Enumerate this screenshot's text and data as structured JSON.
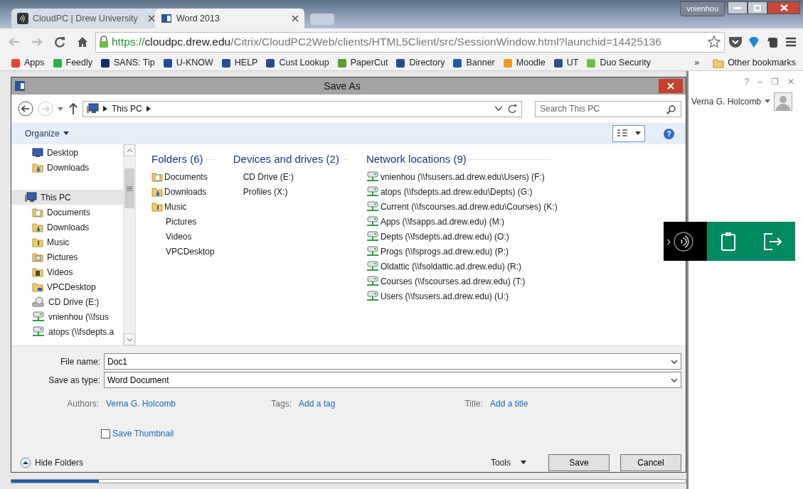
{
  "browser": {
    "tabs": [
      {
        "title": "CloudPC | Drew University",
        "selected": false,
        "kind": "citrix"
      },
      {
        "title": "Word 2013",
        "selected": true,
        "kind": "word"
      }
    ],
    "profile": "vnienhou",
    "url": {
      "scheme": "https://",
      "host": "cloudpc.drew.edu",
      "path": "/Citrix/CloudPC2Web/clients/HTML5Client/src/SessionWindow.html?launchid=14425136"
    },
    "bookmarks": [
      {
        "label": "Apps",
        "color": "#e94235"
      },
      {
        "label": "Feedly",
        "color": "#2bb24c"
      },
      {
        "label": "SANS: Tip",
        "color": "#1a2a6c"
      },
      {
        "label": "U-KNOW",
        "color": "#1f4e9c"
      },
      {
        "label": "HELP",
        "color": "#24508f"
      },
      {
        "label": "Cust Lookup",
        "color": "#2a4a8a"
      },
      {
        "label": "PaperCut",
        "color": "#5aa02c"
      },
      {
        "label": "Directory",
        "color": "#2b4c8c"
      },
      {
        "label": "Banner",
        "color": "#1d5aa8"
      },
      {
        "label": "Moodle",
        "color": "#f29a1f"
      },
      {
        "label": "UT",
        "color": "#2e4d87"
      },
      {
        "label": "Duo Security",
        "color": "#6cc04a"
      }
    ],
    "overflow": "»",
    "other_bookmarks": "Other bookmarks"
  },
  "dialog": {
    "title": "Save As",
    "breadcrumb": [
      "This PC"
    ],
    "search_placeholder": "Search This PC",
    "organize": "Organize",
    "help": "?",
    "nav_items": [
      {
        "label": "Desktop",
        "kind": "monitor",
        "selected": false
      },
      {
        "label": "Downloads",
        "kind": "download",
        "selected": false
      },
      {
        "label": "This PC",
        "kind": "computer",
        "selected": true,
        "children": [
          {
            "label": "Documents",
            "kind": "document",
            "selected": false
          },
          {
            "label": "Downloads",
            "kind": "download",
            "selected": false
          },
          {
            "label": "Music",
            "kind": "music",
            "selected": false
          },
          {
            "label": "Pictures",
            "kind": "pictures",
            "selected": false
          },
          {
            "label": "Videos",
            "kind": "videos",
            "selected": false
          },
          {
            "label": "VPCDesktop",
            "kind": "folder",
            "selected": false
          },
          {
            "label": "CD Drive (E:)",
            "kind": "disc",
            "selected": false
          },
          {
            "label": "vnienhou (\\\\fsus",
            "kind": "network",
            "selected": false
          },
          {
            "label": "atops (\\\\fsdepts.a",
            "kind": "network",
            "selected": false
          }
        ]
      }
    ],
    "groups": [
      {
        "heading": "Folders (6)",
        "items": [
          {
            "label": "Documents",
            "kind": "document",
            "icon": true
          },
          {
            "label": "Downloads",
            "kind": "download",
            "icon": true
          },
          {
            "label": "Music",
            "kind": "music",
            "icon": true
          },
          {
            "label": "Pictures",
            "icon": false
          },
          {
            "label": "Videos",
            "icon": false
          },
          {
            "label": "VPCDesktop",
            "icon": false
          }
        ]
      },
      {
        "heading": "Devices and drives (2)",
        "items": [
          {
            "label": "CD Drive (E:)",
            "icon": false
          },
          {
            "label": "Profiles (X:)",
            "icon": false
          }
        ]
      },
      {
        "heading": "Network locations (9)",
        "items": [
          {
            "label": "vnienhou (\\\\fsusers.ad.drew.edu\\Users) (F:)",
            "kind": "network",
            "icon": true
          },
          {
            "label": "atops (\\\\fsdepts.ad.drew.edu\\Depts) (G:)",
            "kind": "network",
            "icon": true
          },
          {
            "label": "Current (\\\\fscourses.ad.drew.edu\\Courses) (K:)",
            "kind": "network",
            "icon": true
          },
          {
            "label": "Apps (\\\\fsapps.ad.drew.edu) (M:)",
            "kind": "network",
            "icon": true
          },
          {
            "label": "Depts (\\\\fsdepts.ad.drew.edu) (O:)",
            "kind": "network",
            "icon": true
          },
          {
            "label": "Progs (\\\\fsprogs.ad.drew.edu) (P:)",
            "kind": "network",
            "icon": true
          },
          {
            "label": "Oldattic (\\\\fsoldattic.ad.drew.edu) (R:)",
            "kind": "network",
            "icon": true
          },
          {
            "label": "Courses (\\\\fscourses.ad.drew.edu) (T:)",
            "kind": "network",
            "icon": true
          },
          {
            "label": "Users (\\\\fsusers.ad.drew.edu) (U:)",
            "kind": "network",
            "icon": true
          }
        ]
      }
    ],
    "fields": [
      {
        "label": "File name:",
        "value": "Doc1"
      },
      {
        "label": "Save as type:",
        "value": "Word Document"
      }
    ],
    "properties": [
      {
        "label": "Authors:",
        "value": "Verna G. Holcomb"
      },
      {
        "label": "Tags:",
        "value": "Add a tag"
      },
      {
        "label": "Title:",
        "value": "Add a title"
      }
    ],
    "thumbnail": {
      "label": "Save Thumbnail",
      "checked": false
    },
    "hide_folders": "Hide Folders",
    "tools": "Tools",
    "buttons": [
      "Save",
      "Cancel"
    ]
  },
  "account": {
    "window_controls": [
      "?",
      "–",
      "❐",
      "✕"
    ],
    "name": "Verna G. Holcomb"
  },
  "session_toolbar": {
    "expand": "›"
  },
  "progress": {
    "level": 0.13
  }
}
